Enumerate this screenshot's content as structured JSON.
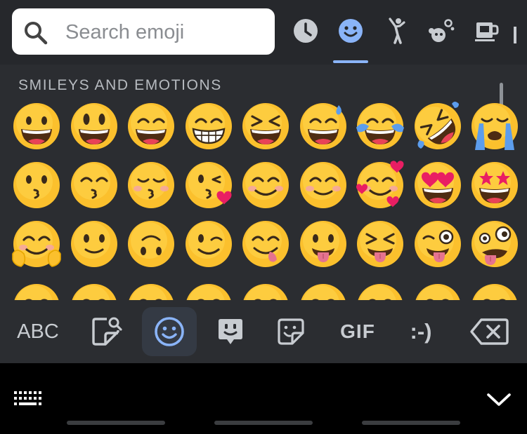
{
  "search": {
    "placeholder": "Search emoji"
  },
  "categories": [
    {
      "name": "recent-icon",
      "color": "#c8ccd1"
    },
    {
      "name": "smiley-icon",
      "color": "#8ab4f8",
      "selected": true
    },
    {
      "name": "person-icon",
      "color": "#c8ccd1"
    },
    {
      "name": "animal-icon",
      "color": "#c8ccd1"
    },
    {
      "name": "food-icon",
      "color": "#c8ccd1"
    }
  ],
  "section": {
    "title": "SMILEYS AND EMOTIONS"
  },
  "emoji_rows": [
    [
      "grinning-face",
      "grinning-face-big-eyes",
      "grinning-face-smiling-eyes",
      "beaming-face",
      "grinning-squinting-face",
      "grinning-face-with-sweat",
      "face-with-tears-of-joy",
      "rolling-on-floor-laughing",
      "loudly-crying-face"
    ],
    [
      "kissing-face",
      "kissing-face-smiling-eyes",
      "kissing-face-closed-eyes",
      "face-blowing-kiss",
      "smiling-face",
      "smiling-face-with-smiling-eyes",
      "smiling-face-with-hearts",
      "smiling-face-with-heart-eyes",
      "star-struck"
    ],
    [
      "hugging-face",
      "slightly-smiling-face",
      "upside-down-face",
      "winking-face",
      "face-savoring-food",
      "face-with-tongue",
      "squinting-face-with-tongue",
      "winking-face-with-tongue",
      "zany-face"
    ]
  ],
  "toolbar": {
    "abc_label": "ABC",
    "gif_label": "GIF",
    "emoticon_label": ":-)",
    "icons": [
      "sticker-search-icon",
      "emoji-icon",
      "bitmoji-icon",
      "sticker-icon",
      "backspace-icon"
    ]
  },
  "navbar": {
    "icons": [
      "keyboard-icon",
      "chevron-down-icon"
    ]
  },
  "colors": {
    "panel": "#2b2d31",
    "topbar": "#26282c",
    "accent": "#8ab4f8",
    "icon": "#c8ccd1",
    "emoji_yellow": "#fbc02d"
  }
}
